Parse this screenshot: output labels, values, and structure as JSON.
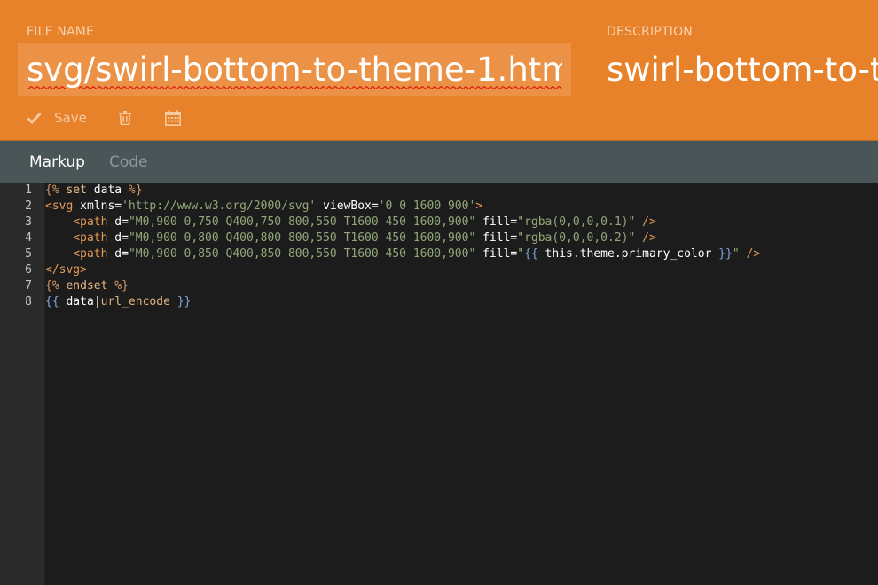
{
  "header": {
    "file_name_label": "FILE NAME",
    "file_name_value": "svg/swirl-bottom-to-theme-1.htm",
    "description_label": "DESCRIPTION",
    "description_value": "swirl-bottom-to-t",
    "save_label": "Save",
    "accent_color": "#e8822a"
  },
  "tabs": [
    {
      "label": "Markup",
      "active": true
    },
    {
      "label": "Code",
      "active": false
    }
  ],
  "editor": {
    "line_numbers": [
      "1",
      "2",
      "3",
      "4",
      "5",
      "6",
      "7",
      "8"
    ],
    "lines": [
      [
        {
          "t": "delim",
          "v": "{%"
        },
        {
          "t": "kw",
          "v": " set "
        },
        {
          "t": "var",
          "v": "data"
        },
        {
          "t": "delim",
          "v": " %}"
        }
      ],
      [
        {
          "t": "tag",
          "v": "<svg"
        },
        {
          "t": "attr",
          "v": " xmlns"
        },
        {
          "t": "eq",
          "v": "="
        },
        {
          "t": "str",
          "v": "'http://www.w3.org/2000/svg'"
        },
        {
          "t": "attr",
          "v": " viewBox"
        },
        {
          "t": "eq",
          "v": "="
        },
        {
          "t": "str",
          "v": "'0 0 1600 900'"
        },
        {
          "t": "tag",
          "v": ">"
        }
      ],
      [
        {
          "t": "tag",
          "v": "    <path"
        },
        {
          "t": "attr",
          "v": " d"
        },
        {
          "t": "eq",
          "v": "="
        },
        {
          "t": "str",
          "v": "\"M0,900 0,750 Q400,750 800,550 T1600 450 1600,900\""
        },
        {
          "t": "attr",
          "v": " fill"
        },
        {
          "t": "eq",
          "v": "="
        },
        {
          "t": "str",
          "v": "\"rgba(0,0,0,0.1)\""
        },
        {
          "t": "tag",
          "v": " />"
        }
      ],
      [
        {
          "t": "tag",
          "v": "    <path"
        },
        {
          "t": "attr",
          "v": " d"
        },
        {
          "t": "eq",
          "v": "="
        },
        {
          "t": "str",
          "v": "\"M0,900 0,800 Q400,800 800,550 T1600 450 1600,900\""
        },
        {
          "t": "attr",
          "v": " fill"
        },
        {
          "t": "eq",
          "v": "="
        },
        {
          "t": "str",
          "v": "\"rgba(0,0,0,0.2)\""
        },
        {
          "t": "tag",
          "v": " />"
        }
      ],
      [
        {
          "t": "tag",
          "v": "    <path"
        },
        {
          "t": "attr",
          "v": " d"
        },
        {
          "t": "eq",
          "v": "="
        },
        {
          "t": "str",
          "v": "\"M0,900 0,850 Q400,850 800,550 T1600 450 1600,900\""
        },
        {
          "t": "attr",
          "v": " fill"
        },
        {
          "t": "eq",
          "v": "="
        },
        {
          "t": "str",
          "v": "\""
        },
        {
          "t": "tdelim",
          "v": "{{"
        },
        {
          "t": "var",
          "v": " this.theme.primary_color "
        },
        {
          "t": "tdelim",
          "v": "}}"
        },
        {
          "t": "str",
          "v": "\""
        },
        {
          "t": "tag",
          "v": " />"
        }
      ],
      [
        {
          "t": "tag",
          "v": "</svg>"
        }
      ],
      [
        {
          "t": "delim",
          "v": "{%"
        },
        {
          "t": "kw",
          "v": " endset "
        },
        {
          "t": "delim",
          "v": "%}"
        }
      ],
      [
        {
          "t": "tdelim",
          "v": "{{"
        },
        {
          "t": "var",
          "v": " data"
        },
        {
          "t": "pipe",
          "v": "|"
        },
        {
          "t": "filter",
          "v": "url_encode"
        },
        {
          "t": "tdelim",
          "v": " }}"
        }
      ]
    ]
  }
}
